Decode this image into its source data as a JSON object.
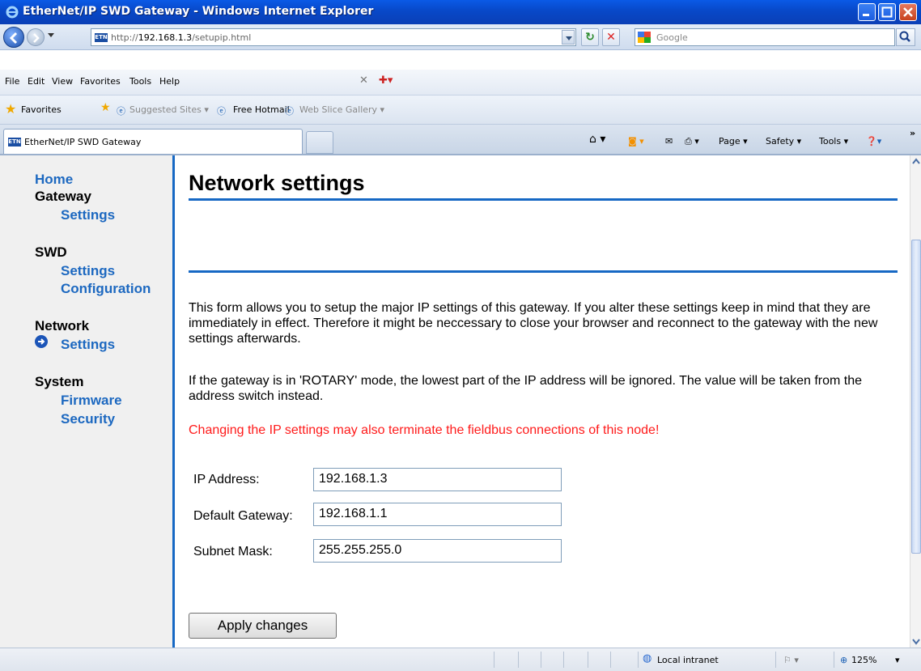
{
  "window": {
    "title": "EtherNet/IP SWD Gateway - Windows Internet Explorer"
  },
  "address_bar": {
    "url_prefix": "http://",
    "url_host": "192.168.1.3",
    "url_path": "/setupip.html",
    "search_placeholder": "Google"
  },
  "menu": {
    "items": [
      "File",
      "Edit",
      "View",
      "Favorites",
      "Tools",
      "Help"
    ]
  },
  "favorites_bar": {
    "favorites_label": "Favorites",
    "suggested_sites": "Suggested Sites",
    "free_hotmail": "Free Hotmail",
    "web_slice_gallery": "Web Slice Gallery"
  },
  "tab": {
    "title": "EtherNet/IP SWD Gateway",
    "favicon_text": "ETN"
  },
  "command_bar": {
    "page": "Page",
    "safety": "Safety",
    "tools": "Tools"
  },
  "sidebar": {
    "home": "Home",
    "gateway": "Gateway",
    "gateway_settings": "Settings",
    "swd": "SWD",
    "swd_settings": "Settings",
    "swd_configuration": "Configuration",
    "network": "Network",
    "network_settings": "Settings",
    "system": "System",
    "system_firmware": "Firmware",
    "system_security": "Security"
  },
  "main": {
    "heading": "Network settings",
    "paragraph1": "This form allows you to setup the major IP settings of this gateway. If you alter these settings keep in mind that they are immediately in effect. Therefore it might be neccessary to close your browser and reconnect to the gateway with the new settings afterwards.",
    "paragraph2": "If the gateway is in 'ROTARY' mode, the lowest part of the IP address will be ignored. The value will be taken from the address switch instead.",
    "warning": "Changing the IP settings may also terminate the fieldbus connections of this node!",
    "fields": {
      "ip_label": "IP Address:",
      "ip_value": "192.168.1.3",
      "gateway_label": "Default Gateway:",
      "gateway_value": "192.168.1.1",
      "subnet_label": "Subnet Mask:",
      "subnet_value": "255.255.255.0"
    },
    "apply_button": "Apply changes"
  },
  "status_bar": {
    "zone": "Local intranet",
    "zoom": "125%"
  },
  "colors": {
    "accent_blue": "#1668c4",
    "link_blue": "#1c68c0",
    "warning_red": "#ff1a1a",
    "sidebar_bg": "#f0f0f0"
  },
  "icons": [
    "ie-logo-icon",
    "minimize-icon",
    "maximize-icon",
    "close-icon",
    "back-icon",
    "forward-icon",
    "refresh-icon",
    "stop-icon",
    "search-icon",
    "favorites-star-icon",
    "home-icon",
    "feeds-icon",
    "mail-icon",
    "print-icon",
    "help-icon",
    "arrow-right-icon",
    "globe-icon",
    "zoom-icon"
  ]
}
